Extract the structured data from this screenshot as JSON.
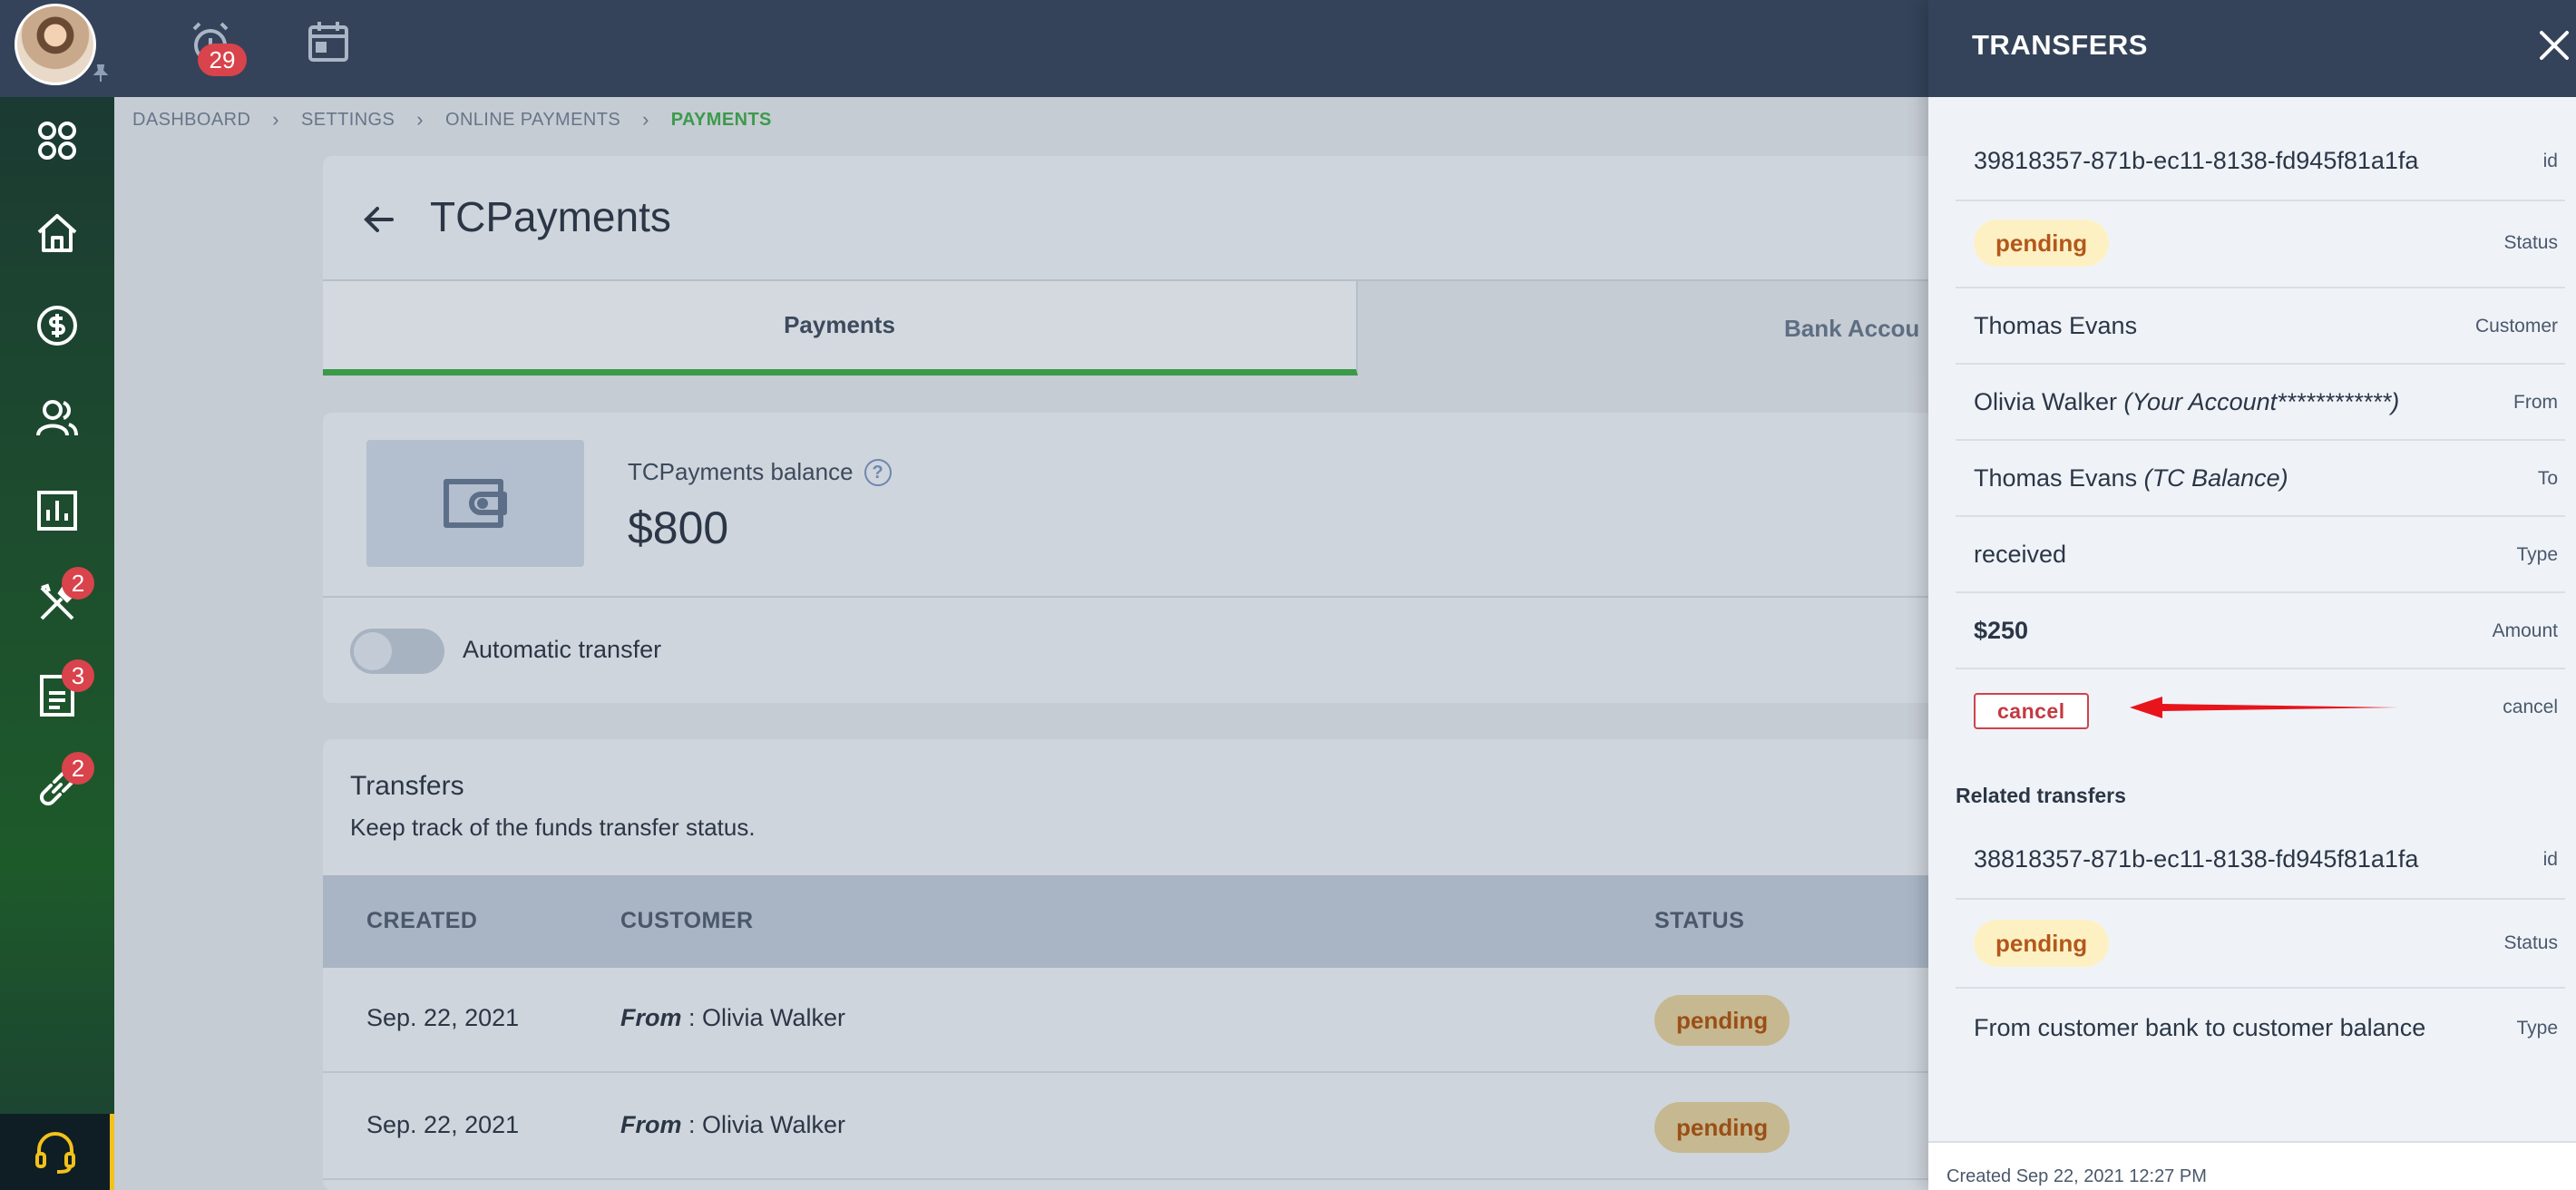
{
  "topbar": {
    "notification_count": "29"
  },
  "sidebar": {
    "items": [
      {
        "icon": "apps-icon",
        "badge": ""
      },
      {
        "icon": "home-icon",
        "badge": ""
      },
      {
        "icon": "dollar-icon",
        "badge": ""
      },
      {
        "icon": "users-icon",
        "badge": ""
      },
      {
        "icon": "chart-icon",
        "badge": ""
      },
      {
        "icon": "tools-icon",
        "badge": "2"
      },
      {
        "icon": "document-icon",
        "badge": "3"
      },
      {
        "icon": "link-icon",
        "badge": "2"
      }
    ],
    "support_icon": "headset-icon"
  },
  "breadcrumb": {
    "items": [
      "DASHBOARD",
      "SETTINGS",
      "ONLINE PAYMENTS",
      "PAYMENTS"
    ]
  },
  "header": {
    "title": "TCPayments",
    "tabs": [
      "Payments",
      "Bank Accou"
    ]
  },
  "balance": {
    "label": "TCPayments balance",
    "help": "?",
    "value": "$800",
    "auto_transfer_label": "Automatic transfer",
    "auto_transfer_on": false
  },
  "transfers": {
    "title": "Transfers",
    "subtitle": "Keep track of the funds transfer status.",
    "columns": [
      "CREATED",
      "CUSTOMER",
      "STATUS"
    ],
    "rows": [
      {
        "created": "Sep. 22, 2021",
        "from_label": "From",
        "customer": " : Olivia Walker",
        "status": "pending"
      },
      {
        "created": "Sep. 22, 2021",
        "from_label": "From",
        "customer": " : Olivia Walker",
        "status": "pending"
      }
    ]
  },
  "drawer": {
    "title": "TRANSFERS",
    "details": {
      "id": {
        "value": "39818357-871b-ec11-8138-fd945f81a1fa",
        "key": "id"
      },
      "status": {
        "value": "pending",
        "key": "Status"
      },
      "customer": {
        "value": "Thomas Evans",
        "key": "Customer"
      },
      "from": {
        "name": "Olivia Walker",
        "note": "(Your Account************)",
        "key": "From"
      },
      "to": {
        "name": "Thomas Evans",
        "note": "(TC Balance)",
        "key": "To"
      },
      "type": {
        "value": "received",
        "key": "Type"
      },
      "amount": {
        "value": "$250",
        "key": "Amount"
      },
      "cancel": {
        "button": "cancel",
        "key": "cancel"
      }
    },
    "related_title": "Related transfers",
    "related": {
      "id": {
        "value": "38818357-871b-ec11-8138-fd945f81a1fa",
        "key": "id"
      },
      "status": {
        "value": "pending",
        "key": "Status"
      },
      "type": {
        "value": "From customer bank to customer balance",
        "key": "Type"
      }
    },
    "footer": "Created Sep 22, 2021 12:27 PM"
  },
  "colors": {
    "accent_green": "#3a9a48",
    "danger": "#d9434b",
    "pending_bg": "#fdf1c4",
    "pending_text": "#b3581a",
    "annotation_arrow": "#e8141b"
  }
}
